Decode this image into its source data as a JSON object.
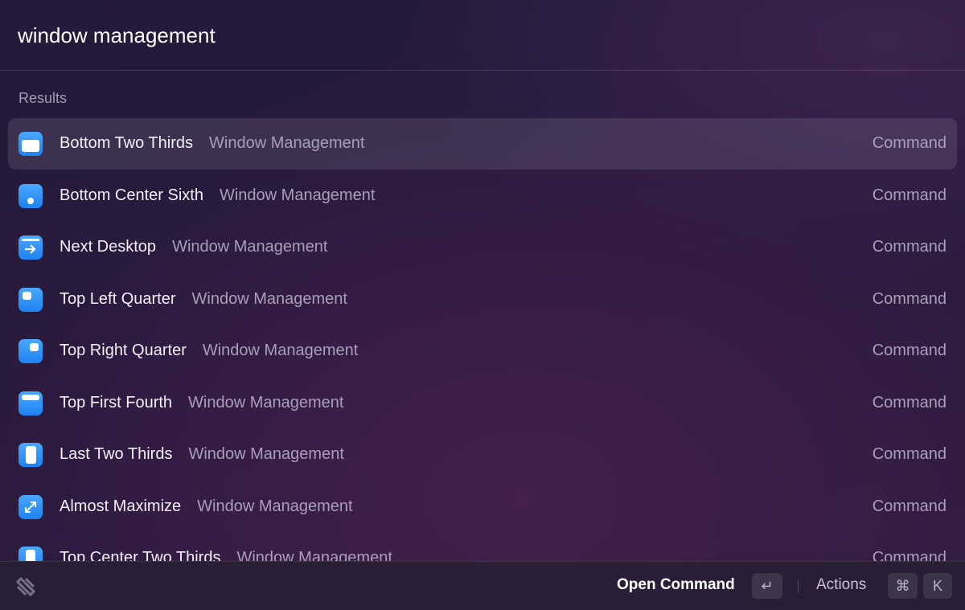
{
  "search": {
    "value": "window management"
  },
  "section_label": "Results",
  "results": [
    {
      "title": "Bottom Two Thirds",
      "subtitle": "Window Management",
      "accessory": "Command",
      "icon": "bottom-two-thirds-icon",
      "selected": true
    },
    {
      "title": "Bottom Center Sixth",
      "subtitle": "Window Management",
      "accessory": "Command",
      "icon": "bottom-center-sixth-icon"
    },
    {
      "title": "Next Desktop",
      "subtitle": "Window Management",
      "accessory": "Command",
      "icon": "next-desktop-icon"
    },
    {
      "title": "Top Left Quarter",
      "subtitle": "Window Management",
      "accessory": "Command",
      "icon": "top-left-quarter-icon"
    },
    {
      "title": "Top Right Quarter",
      "subtitle": "Window Management",
      "accessory": "Command",
      "icon": "top-right-quarter-icon"
    },
    {
      "title": "Top First Fourth",
      "subtitle": "Window Management",
      "accessory": "Command",
      "icon": "top-first-fourth-icon"
    },
    {
      "title": "Last Two Thirds",
      "subtitle": "Window Management",
      "accessory": "Command",
      "icon": "last-two-thirds-icon"
    },
    {
      "title": "Almost Maximize",
      "subtitle": "Window Management",
      "accessory": "Command",
      "icon": "almost-maximize-icon"
    },
    {
      "title": "Top Center Two Thirds",
      "subtitle": "Window Management",
      "accessory": "Command",
      "icon": "top-center-two-thirds-icon"
    }
  ],
  "footer": {
    "primary_action": "Open Command",
    "primary_key": "↵",
    "actions_label": "Actions",
    "actions_keys": [
      "⌘",
      "K"
    ]
  },
  "colors": {
    "accent_icon": "#2f95fa",
    "background": "#2a1a3e"
  }
}
